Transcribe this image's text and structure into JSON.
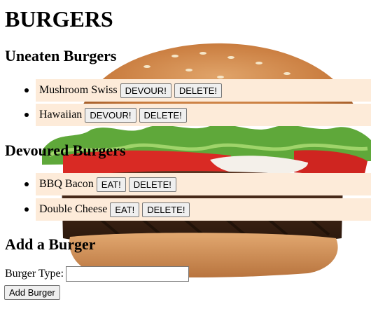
{
  "page": {
    "title": "BURGERS"
  },
  "uneaten": {
    "heading": "Uneaten Burgers",
    "items": [
      {
        "name": "Mushroom Swiss",
        "primary_label": "DEVOUR!",
        "delete_label": "DELETE!"
      },
      {
        "name": "Hawaiian",
        "primary_label": "DEVOUR!",
        "delete_label": "DELETE!"
      }
    ]
  },
  "devoured": {
    "heading": "Devoured Burgers",
    "items": [
      {
        "name": "BBQ Bacon",
        "primary_label": "EAT!",
        "delete_label": "DELETE!"
      },
      {
        "name": "Double Cheese",
        "primary_label": "EAT!",
        "delete_label": "DELETE!"
      }
    ]
  },
  "add_form": {
    "heading": "Add a Burger",
    "field_label": "Burger Type:",
    "field_value": "",
    "submit_label": "Add Burger"
  },
  "colors": {
    "row_background": "#fdebd9",
    "button_background": "#efefef"
  }
}
